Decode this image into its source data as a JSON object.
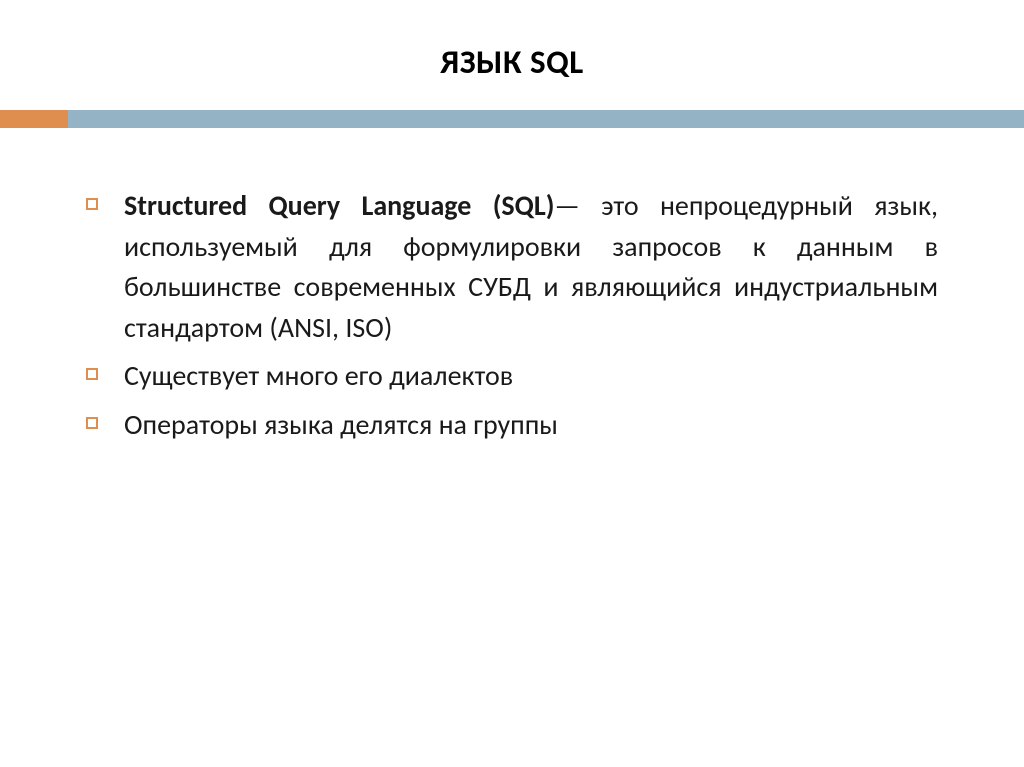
{
  "slide": {
    "title": "ЯЗЫК SQL",
    "bullets": [
      {
        "bold_prefix": "Structured Query Language (SQL)",
        "text": "— это непроцедурный язык, используемый для формулировки запросов к данным в большинстве современных СУБД и являющийся индустриальным стандартом (ANSI, ISO)",
        "justified": true
      },
      {
        "bold_prefix": "",
        "text": "Существует много его диалектов",
        "justified": false
      },
      {
        "bold_prefix": "",
        "text": "Операторы языка делятся на группы",
        "justified": false
      }
    ]
  },
  "colors": {
    "divider_bar": "#94b3c4",
    "accent": "#e08e4f"
  }
}
